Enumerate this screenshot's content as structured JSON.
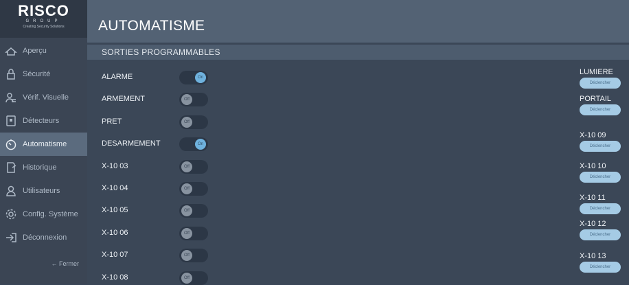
{
  "logo": {
    "word": "RISCO",
    "group": "GROUP",
    "tagline": "Creating Security Solutions"
  },
  "nav": {
    "items": [
      {
        "label": "Aperçu",
        "icon": "home-icon",
        "active": false
      },
      {
        "label": "Sécurité",
        "icon": "lock-icon",
        "active": false
      },
      {
        "label": "Vérif. Visuelle",
        "icon": "people-icon",
        "active": false
      },
      {
        "label": "Détecteurs",
        "icon": "detector-icon",
        "active": false
      },
      {
        "label": "Automatisme",
        "icon": "clock-icon",
        "active": true
      },
      {
        "label": "Historique",
        "icon": "history-icon",
        "active": false
      },
      {
        "label": "Utilisateurs",
        "icon": "user-icon",
        "active": false
      },
      {
        "label": "Config. Système",
        "icon": "gear-icon",
        "active": false
      },
      {
        "label": "Déconnexion",
        "icon": "logout-icon",
        "active": false
      }
    ],
    "fermer": "← Fermer"
  },
  "header": {
    "title": "AUTOMATISME"
  },
  "section": {
    "title": "SORTIES PROGRAMMABLES"
  },
  "toggle_text": {
    "on": "On",
    "off": "Off"
  },
  "outputs": [
    {
      "label": "ALARME",
      "state": "on"
    },
    {
      "label": "ARMEMENT",
      "state": "off"
    },
    {
      "label": "PRET",
      "state": "off"
    },
    {
      "label": "DESARMEMENT",
      "state": "on"
    },
    {
      "label": "X-10 03",
      "state": "off"
    },
    {
      "label": "X-10 04",
      "state": "off"
    },
    {
      "label": "X-10 05",
      "state": "off"
    },
    {
      "label": "X-10 06",
      "state": "off"
    },
    {
      "label": "X-10 07",
      "state": "off"
    },
    {
      "label": "X-10 08",
      "state": "off"
    }
  ],
  "triggers": [
    {
      "label": "LUMIERE",
      "button": "Déclencher"
    },
    {
      "label": "PORTAIL",
      "button": "Déclencher"
    },
    {
      "label": "X-10 09",
      "button": "Déclencher"
    },
    {
      "label": "X-10 10",
      "button": "Déclencher"
    },
    {
      "label": "X-10 11",
      "button": "Déclencher"
    },
    {
      "label": "X-10 12",
      "button": "Déclencher"
    },
    {
      "label": "X-10 13",
      "button": "Déclencher"
    }
  ],
  "colors": {
    "active_nav": "#5b6b7e",
    "toggle_on": "#6fb2de",
    "trigger_button": "#a5cbe5"
  }
}
